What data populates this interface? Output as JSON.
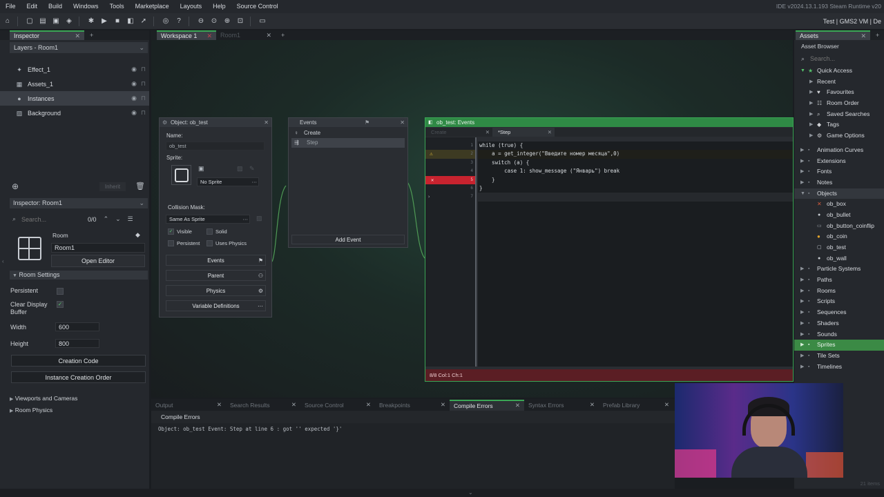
{
  "menu": [
    "File",
    "Edit",
    "Build",
    "Windows",
    "Tools",
    "Marketplace",
    "Layouts",
    "Help",
    "Source Control"
  ],
  "ide_version": "IDE v2024.13.1.193 Steam  Runtime v20",
  "target": "Test  |  GMS2 VM  |  De",
  "inspector": {
    "tab_label": "Inspector",
    "layers_header": "Layers - Room1",
    "layers": [
      {
        "name": "Effect_1",
        "icon": "effect-icon"
      },
      {
        "name": "Assets_1",
        "icon": "assets-layer-icon"
      },
      {
        "name": "Instances",
        "icon": "instances-layer-icon",
        "selected": true
      },
      {
        "name": "Background",
        "icon": "background-layer-icon"
      }
    ],
    "inherit_label": "Inherit",
    "room_header": "Inspector: Room1",
    "search_placeholder": "Search...",
    "count": "0/0",
    "room_type": "Room",
    "room_name": "Room1",
    "open_editor": "Open Editor",
    "room_settings": "Room Settings",
    "persistent": "Persistent",
    "clear_display": "Clear Display",
    "buffer": "Buffer",
    "width_label": "Width",
    "width_value": "600",
    "height_label": "Height",
    "height_value": "800",
    "creation_code": "Creation Code",
    "instance_order": "Instance Creation Order",
    "viewports": "Viewports and Cameras",
    "room_physics": "Room Physics"
  },
  "workspace": {
    "tab_label": "Workspace 1",
    "tab2_label": "Room1"
  },
  "object_win": {
    "title": "Object: ob_test",
    "name_label": "Name:",
    "name_value": "ob_test",
    "sprite_label": "Sprite:",
    "no_sprite": "No Sprite",
    "collision_label": "Collision Mask:",
    "collision_value": "Same As Sprite",
    "visible": "Visible",
    "solid": "Solid",
    "persistent": "Persistent",
    "uses_physics": "Uses Physics",
    "events_btn": "Events",
    "parent_btn": "Parent",
    "physics_btn": "Physics",
    "vardefs_btn": "Variable Definitions"
  },
  "events_win": {
    "title": "Events",
    "events": [
      "Create",
      "Step"
    ],
    "add_event": "Add Event"
  },
  "code_win": {
    "title": "ob_test: Events",
    "tab_create": "Create",
    "tab_step": "*Step",
    "lines": [
      {
        "num": "1",
        "text": "while (true) {"
      },
      {
        "num": "2",
        "text": "    a = get_integer(\"Введите номер месяца\",0)"
      },
      {
        "num": "3",
        "text": "    switch (a) {"
      },
      {
        "num": "4",
        "text": "        case 1: show_message (\"Январь\") break"
      },
      {
        "num": "5",
        "text": "    }"
      },
      {
        "num": "6",
        "text": "}"
      },
      {
        "num": "7",
        "text": ""
      }
    ],
    "status": "8/8 Col:1 Ch:1"
  },
  "assets": {
    "tab_label": "Assets",
    "browser_label": "Asset Browser",
    "search_placeholder": "Search...",
    "quick_access": "Quick Access",
    "quick_items": [
      "Recent",
      "Favourites",
      "Room Order",
      "Saved Searches",
      "Tags",
      "Game Options"
    ],
    "groups_before": [
      "Animation Curves",
      "Extensions",
      "Fonts",
      "Notes"
    ],
    "objects_label": "Objects",
    "objects": [
      "ob_box",
      "ob_bullet",
      "ob_button_coinflip",
      "ob_coin",
      "ob_test",
      "ob_wall"
    ],
    "groups_after": [
      "Particle Systems",
      "Paths",
      "Rooms",
      "Scripts",
      "Sequences",
      "Shaders",
      "Sounds"
    ],
    "sprites_label": "Sprites",
    "groups_end": [
      "Tile Sets",
      "Timelines"
    ],
    "items_count": "21 items"
  },
  "bottom": {
    "tabs": [
      "Output",
      "Search Results",
      "Source Control",
      "Breakpoints",
      "Compile Errors",
      "Syntax Errors",
      "Prefab Library"
    ],
    "active_tab": "Compile Errors",
    "header": "Compile Errors",
    "error_line": "Object: ob_test Event: Step at line 6 : got '' expected '}'"
  },
  "colors": {
    "accent": "#3aa655",
    "error": "#c8232f",
    "warning": "#d9b53a"
  }
}
